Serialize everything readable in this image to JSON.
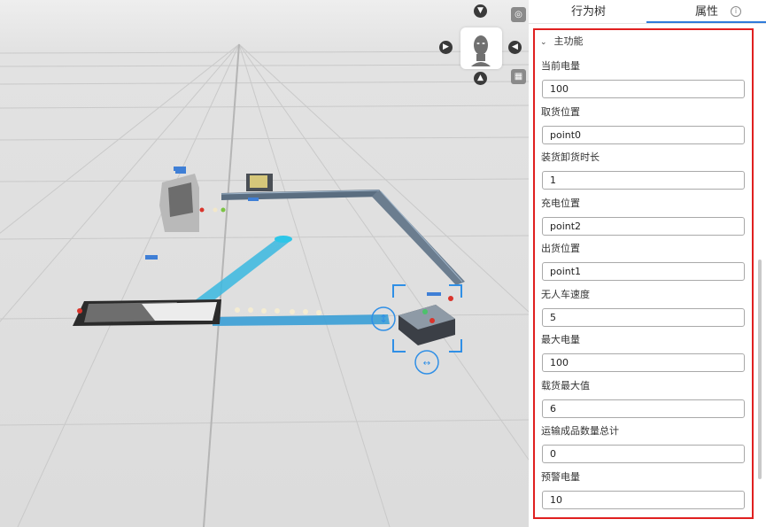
{
  "tabs": [
    {
      "label": "行为树"
    },
    {
      "label": "属性"
    }
  ],
  "info_icon_glyph": "i",
  "section": {
    "title": "主功能",
    "chevron": "⌄"
  },
  "fields": [
    {
      "label": "当前电量",
      "value": "100"
    },
    {
      "label": "取货位置",
      "value": "point0"
    },
    {
      "label": "装货卸货时长",
      "value": "1"
    },
    {
      "label": "充电位置",
      "value": "point2"
    },
    {
      "label": "出货位置",
      "value": "point1"
    },
    {
      "label": "无人车速度",
      "value": "5"
    },
    {
      "label": "最大电量",
      "value": "100"
    },
    {
      "label": "载货最大值",
      "value": "6"
    },
    {
      "label": "运输成品数量总计",
      "value": "0"
    },
    {
      "label": "预警电量",
      "value": "10"
    }
  ],
  "viewport": {
    "nav_icons": {
      "up": "chevron-up-icon",
      "down": "chevron-down-icon",
      "left": "chevron-left-icon",
      "right": "chevron-right-icon"
    },
    "tools": {
      "screenshot": "screenshot-icon",
      "grid": "grid-icon"
    },
    "colors": {
      "accent": "#2f8fe6",
      "selection": "#1e88e5",
      "conveyor": "#34c6e0"
    }
  }
}
